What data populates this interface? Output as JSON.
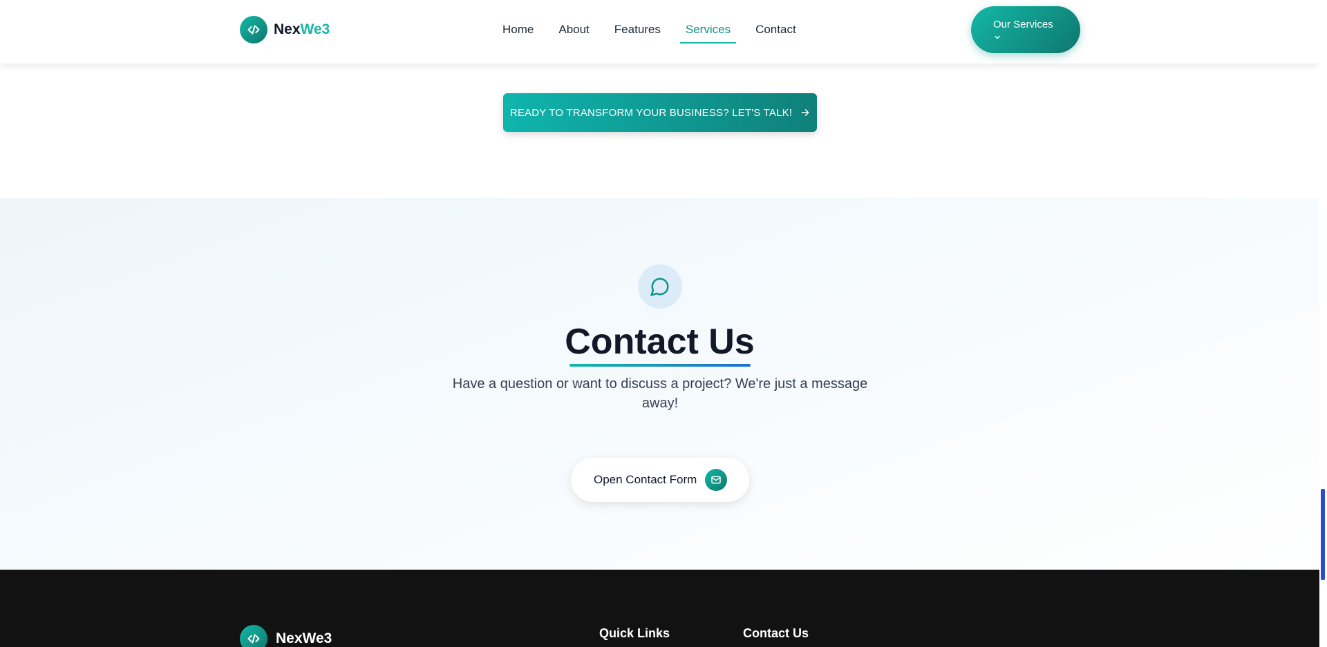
{
  "header": {
    "logo_prefix": "Nex",
    "logo_accent": "We3",
    "nav": [
      {
        "label": "Home",
        "active": false
      },
      {
        "label": "About",
        "active": false
      },
      {
        "label": "Features",
        "active": false
      },
      {
        "label": "Services",
        "active": true
      },
      {
        "label": "Contact",
        "active": false
      }
    ],
    "services_button": "Our Services"
  },
  "cta": {
    "label": "READY TO TRANSFORM YOUR BUSINESS? LET'S TALK!"
  },
  "contact": {
    "title": "Contact Us",
    "subtitle": "Have a question or want to discuss a project? We're just a message away!",
    "open_form_button": "Open Contact Form"
  },
  "footer": {
    "logo_text": "NexWe3",
    "quick_links_heading": "Quick Links",
    "contact_heading": "Contact Us"
  },
  "icons": {
    "logo": "code-icon",
    "services_chevron": "chevron-down-icon",
    "cta_arrow": "arrow-right-icon",
    "contact_badge": "chat-bubble-icon",
    "form_button": "mail-icon"
  },
  "colors": {
    "accent": "#14b8a6",
    "accent_dark": "#0f766e",
    "footer_bg": "#121212",
    "scrollbar_thumb": "#2b4ed1"
  }
}
